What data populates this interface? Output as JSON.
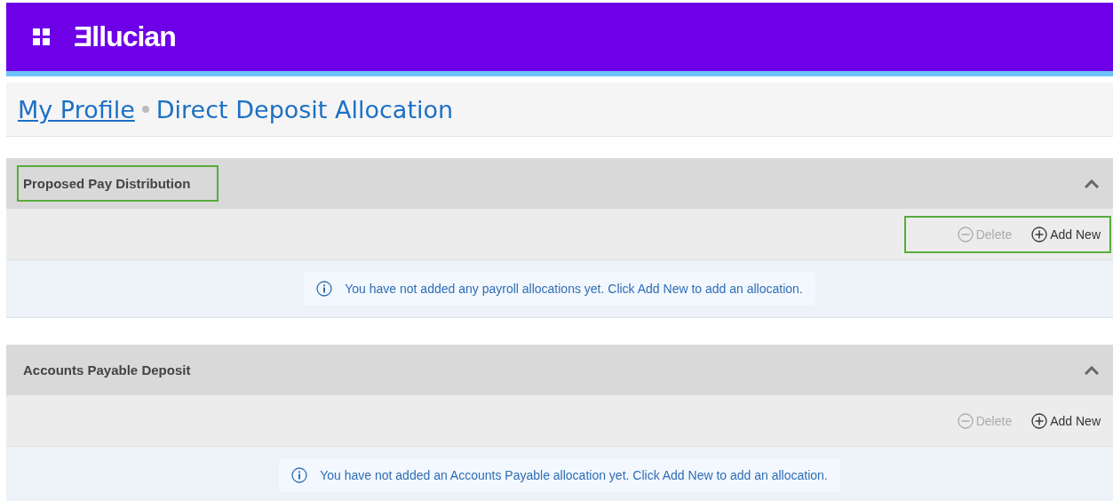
{
  "header": {
    "logo": "Ǝllucian"
  },
  "breadcrumb": {
    "parent": "My Profile",
    "current": "Direct Deposit Allocation"
  },
  "sections": [
    {
      "title": "Proposed Pay Distribution",
      "expanded": true,
      "title_highlighted": true,
      "actions_highlighted": true,
      "actions": [
        {
          "kind": "delete",
          "label": "Delete",
          "disabled": true
        },
        {
          "kind": "add",
          "label": "Add New",
          "disabled": false
        }
      ],
      "message": "You have not added any payroll allocations yet. Click Add New to add an allocation."
    },
    {
      "title": "Accounts Payable Deposit",
      "expanded": true,
      "title_highlighted": false,
      "actions_highlighted": false,
      "actions": [
        {
          "kind": "delete",
          "label": "Delete",
          "disabled": true
        },
        {
          "kind": "add",
          "label": "Add New",
          "disabled": false
        }
      ],
      "message": "You have not added an Accounts Payable allocation yet. Click Add New to add an allocation."
    }
  ]
}
